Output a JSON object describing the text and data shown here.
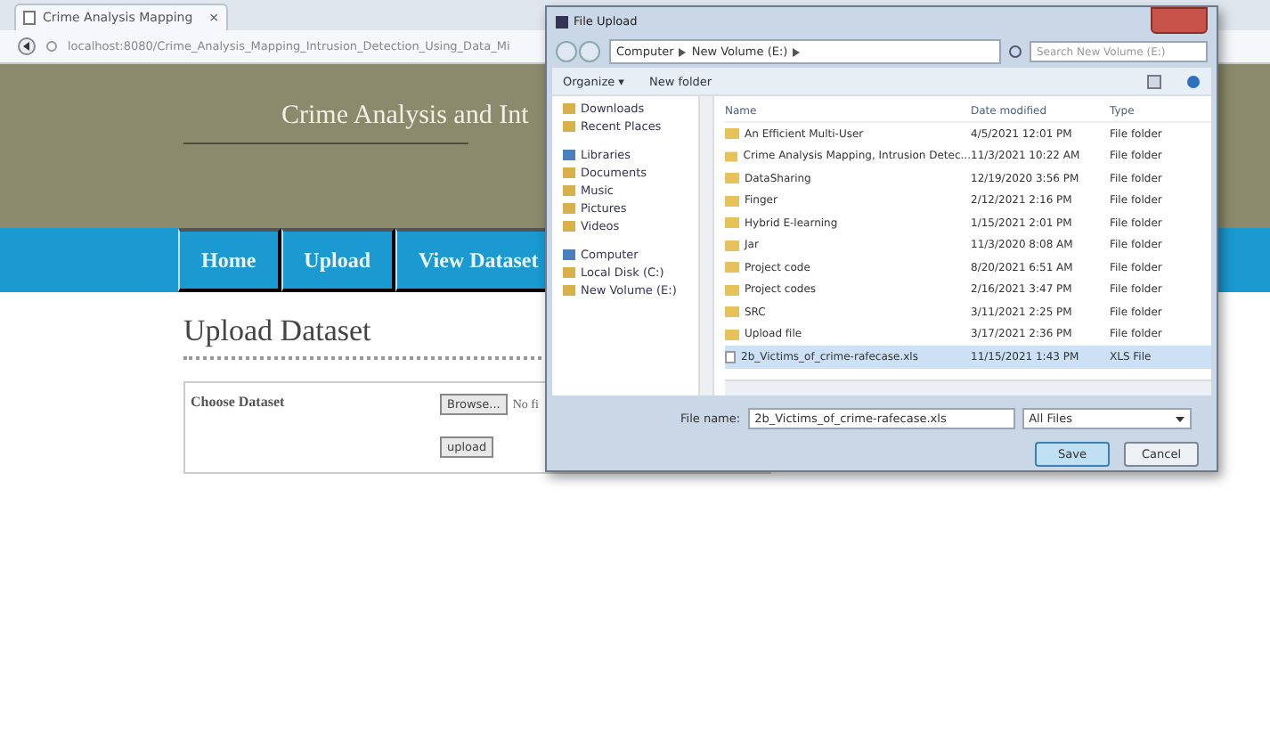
{
  "browser": {
    "tab_title": "Crime Analysis Mapping",
    "tab_close": "×",
    "url": "localhost:8080/Crime_Analysis_Mapping_Intrusion_Detection_Using_Data_Mi"
  },
  "site": {
    "title": "Crime Analysis and Int",
    "nav": [
      {
        "label": "Home",
        "selected": false
      },
      {
        "label": "Upload",
        "selected": false
      },
      {
        "label": "View Dataset",
        "selected": false
      }
    ],
    "heading": "Upload Dataset",
    "form": {
      "label": "Choose Dataset",
      "browse": "Browse...",
      "no_file": "No fi",
      "upload": "upload"
    }
  },
  "dialog": {
    "title": "File Upload",
    "path": [
      "Computer",
      "New Volume (E:)"
    ],
    "search": {
      "placeholder": "Search New Volume (E:)"
    },
    "toolbar": [
      "Organize ▾",
      "New folder"
    ],
    "nav_pane": [
      {
        "label": "Downloads",
        "kind": "item"
      },
      {
        "label": "Recent Places",
        "kind": "item"
      },
      {
        "label": "Libraries",
        "kind": "group"
      },
      {
        "label": "Documents",
        "kind": "item"
      },
      {
        "label": "Music",
        "kind": "item"
      },
      {
        "label": "Pictures",
        "kind": "item"
      },
      {
        "label": "Videos",
        "kind": "item"
      },
      {
        "label": "Computer",
        "kind": "group"
      },
      {
        "label": "Local Disk (C:)",
        "kind": "item"
      },
      {
        "label": "New Volume (E:)",
        "kind": "item"
      }
    ],
    "columns": [
      "Name",
      "Date modified",
      "Type"
    ],
    "rows": [
      {
        "name": "An Efficient Multi-User",
        "date": "4/5/2021 12:01 PM",
        "type": "File folder",
        "kind": "folder",
        "selected": false
      },
      {
        "name": "Crime Analysis Mapping, Intrusion Detec...",
        "date": "11/3/2021 10:22 AM",
        "type": "File folder",
        "kind": "folder",
        "selected": false
      },
      {
        "name": "DataSharing",
        "date": "12/19/2020 3:56 PM",
        "type": "File folder",
        "kind": "folder",
        "selected": false
      },
      {
        "name": "Finger",
        "date": "2/12/2021 2:16 PM",
        "type": "File folder",
        "kind": "folder",
        "selected": false
      },
      {
        "name": "Hybrid E-learning",
        "date": "1/15/2021 2:01 PM",
        "type": "File folder",
        "kind": "folder",
        "selected": false
      },
      {
        "name": "Jar",
        "date": "11/3/2020 8:08 AM",
        "type": "File folder",
        "kind": "folder",
        "selected": false
      },
      {
        "name": "Project code",
        "date": "8/20/2021 6:51 AM",
        "type": "File folder",
        "kind": "folder",
        "selected": false
      },
      {
        "name": "Project codes",
        "date": "2/16/2021 3:47 PM",
        "type": "File folder",
        "kind": "folder",
        "selected": false
      },
      {
        "name": "SRC",
        "date": "3/11/2021 2:25 PM",
        "type": "File folder",
        "kind": "folder",
        "selected": false
      },
      {
        "name": "Upload file",
        "date": "3/17/2021 2:36 PM",
        "type": "File folder",
        "kind": "folder",
        "selected": false
      },
      {
        "name": "2b_Victims_of_crime-rafecase.xls",
        "date": "11/15/2021 1:43 PM",
        "type": "XLS File",
        "kind": "file",
        "selected": true
      }
    ],
    "file_name_label": "File name:",
    "file_name": "2b_Victims_of_crime-rafecase.xls",
    "file_type": "All Files",
    "buttons": [
      "Save",
      "Cancel"
    ]
  }
}
